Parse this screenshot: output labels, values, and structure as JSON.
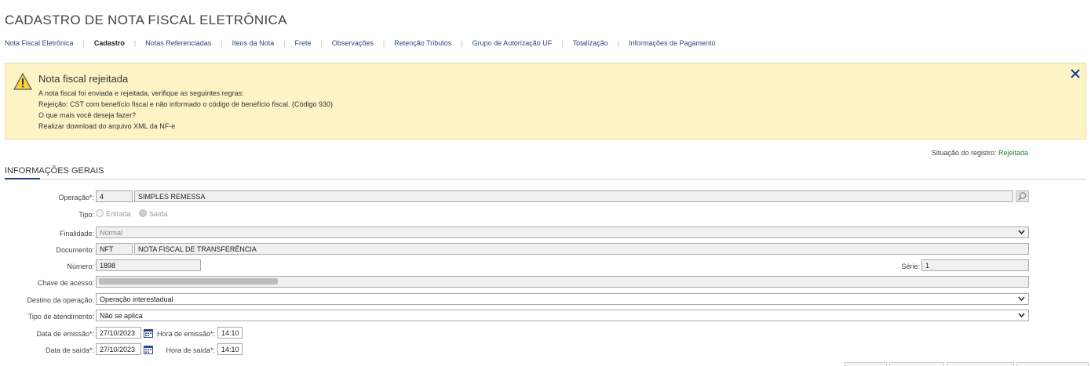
{
  "page": {
    "title": "CADASTRO DE NOTA FISCAL ELETRÔNICA"
  },
  "tabs": [
    {
      "label": "Nota Fiscal Eletrônica",
      "active": false
    },
    {
      "label": "Cadastro",
      "active": true
    },
    {
      "label": "Notas Referenciadas",
      "active": false
    },
    {
      "label": "Itens da Nota",
      "active": false
    },
    {
      "label": "Frete",
      "active": false
    },
    {
      "label": "Observações",
      "active": false
    },
    {
      "label": "Retenção Tributos",
      "active": false
    },
    {
      "label": "Grupo de Autorização UF",
      "active": false
    },
    {
      "label": "Totalização",
      "active": false
    },
    {
      "label": "Informações de Pagamento",
      "active": false
    }
  ],
  "alert": {
    "title": "Nota fiscal rejeitada",
    "line1": "A nota fiscal foi enviada e rejeitada, verifique as seguintes regras:",
    "line2": "Rejeição: CST com benefício fiscal e não informado o código de benefício fiscal. (Código 930)",
    "line3": "O que mais você deseja fazer?",
    "line4": "Realizar download do arquivo XML da NF-e",
    "close_icon": "close-icon",
    "warning_icon": "warning-icon"
  },
  "status": {
    "label": "Situação do registro:",
    "value": "Rejeitada"
  },
  "section": {
    "title": "INFORMAÇÕES GERAIS"
  },
  "form": {
    "operacao": {
      "label": "Operação*:",
      "code": "4",
      "desc": "SIMPLES REMESSA"
    },
    "tipo": {
      "label": "Tipo:",
      "opt1": "Entrada",
      "opt2": "Saída"
    },
    "finalidade": {
      "label": "Finalidade:",
      "value": "Normal"
    },
    "documento": {
      "label": "Documento:",
      "code": "NFT",
      "desc": "NOTA FISCAL DE TRANSFERÊNCIA"
    },
    "numero": {
      "label": "Número:",
      "value": "1898"
    },
    "serie": {
      "label": "Série:",
      "value": "1"
    },
    "chave": {
      "label": "Chave de acesso:"
    },
    "destino": {
      "label": "Destino da operação:",
      "value": "Operação interestadual"
    },
    "atendimento": {
      "label": "Tipo de atendimento:",
      "value": "Não se aplica"
    },
    "data_emissao": {
      "label": "Data de emissão*:",
      "value": "27/10/2023"
    },
    "hora_emissao": {
      "label": "Hora de emissão*:",
      "value": "14:10"
    },
    "data_saida": {
      "label": "Data de saída*:",
      "value": "27/10/2023"
    },
    "hora_saida": {
      "label": "Hora de saída*:",
      "value": "14:10"
    }
  },
  "colors": {
    "accent": "#1f3f7a",
    "alert_bg": "#fcf4c6",
    "status_ok": "#2e7d32"
  }
}
